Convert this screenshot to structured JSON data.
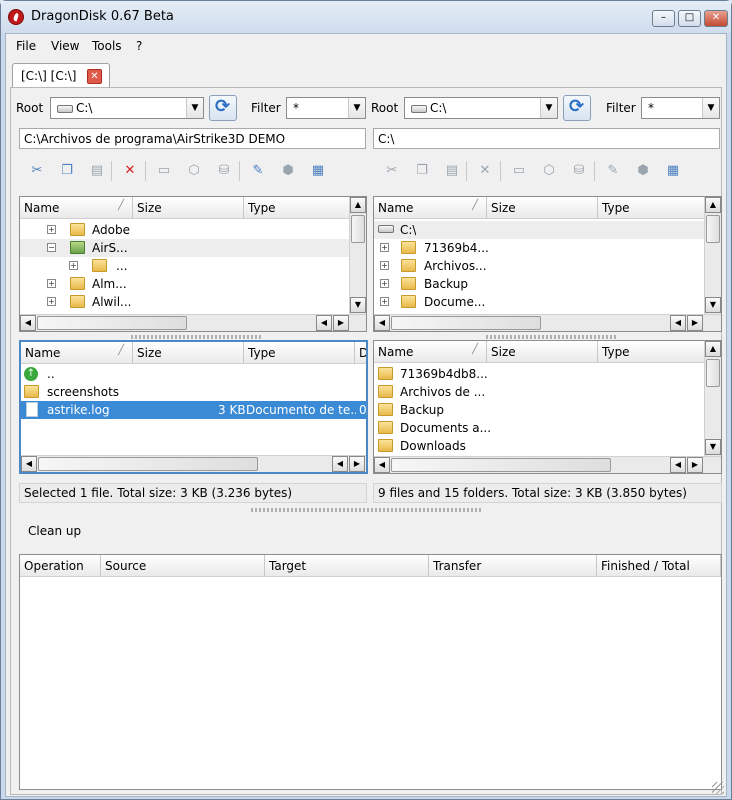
{
  "window": {
    "title": "DragonDisk 0.67 Beta",
    "minimize": "–",
    "maximize": "□",
    "close": "✕"
  },
  "menu": [
    "File",
    "View",
    "Tools",
    "?"
  ],
  "tab": {
    "label": "[C:\\] [C:\\]",
    "close": "✕"
  },
  "left": {
    "root_label": "Root",
    "root_value": "C:\\",
    "filter_label": "Filter",
    "filter_value": "*",
    "path": "C:\\Archivos de programa\\AirStrike3D DEMO",
    "tree_columns": [
      "Name",
      "Size",
      "Type"
    ],
    "tree_rows": [
      "Adobe",
      "AirS...",
      "...",
      "Alm...",
      "Alwil..."
    ],
    "list_columns": [
      "Name",
      "Size",
      "Type",
      "D"
    ],
    "list_rows": [
      {
        "name": "..",
        "size": "",
        "type": ""
      },
      {
        "name": "screenshots",
        "size": "",
        "type": ""
      },
      {
        "name": "astrike.log",
        "size": "3 KB",
        "type": "Documento de te...",
        "extra": "0"
      }
    ],
    "status": "Selected 1 file. Total size: 3 KB (3.236 bytes)"
  },
  "right": {
    "root_label": "Root",
    "root_value": "C:\\",
    "filter_label": "Filter",
    "filter_value": "*",
    "path": "C:\\",
    "tree_columns": [
      "Name",
      "Size",
      "Type"
    ],
    "tree_rows": [
      "C:\\",
      "71369b4...",
      "Archivos...",
      "Backup",
      "Docume..."
    ],
    "list_columns": [
      "Name",
      "Size",
      "Type"
    ],
    "list_rows": [
      "71369b4db8...",
      "Archivos de ...",
      "Backup",
      "Documents a...",
      "Downloads"
    ],
    "status": "9 files and 15 folders. Total size: 3 KB (3.850 bytes)"
  },
  "cleanup_label": "Clean up",
  "transfer_columns": [
    "Operation",
    "Source",
    "Target",
    "Transfer",
    "Finished / Total"
  ],
  "toolbar_icons": [
    "cut-icon",
    "copy-icon",
    "paste-icon",
    "delete-icon",
    "new-folder-icon",
    "new-bucket-icon",
    "cdn-icon",
    "properties-icon",
    "acl-icon",
    "view-options-icon"
  ]
}
